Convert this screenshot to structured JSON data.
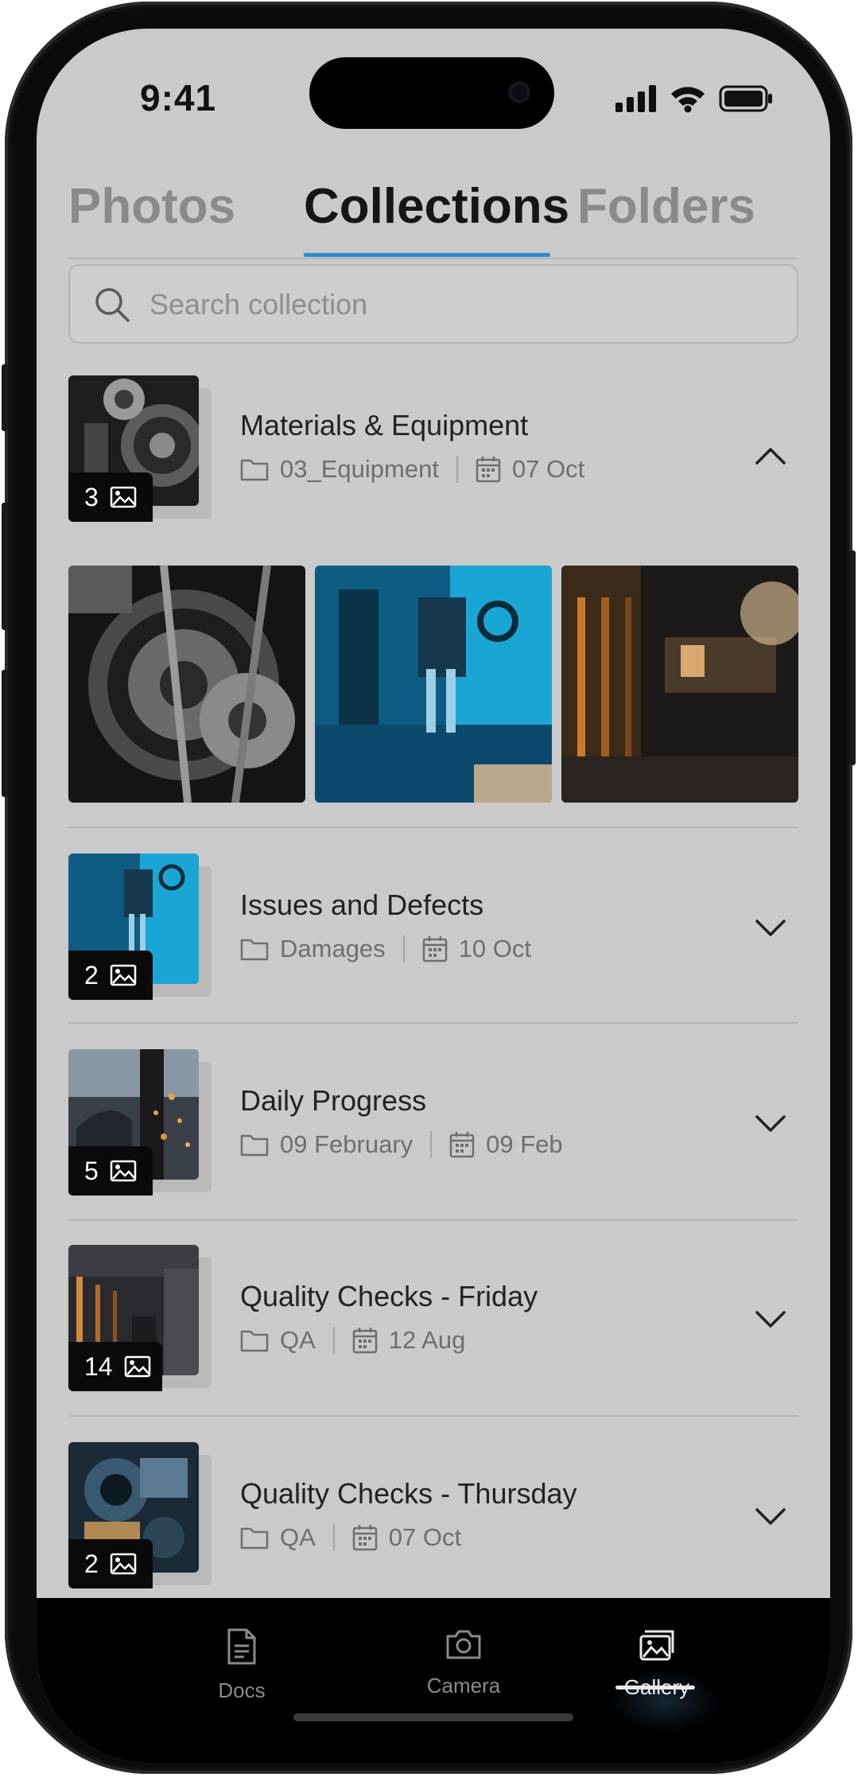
{
  "status_bar": {
    "time": "9:41"
  },
  "tabs": [
    {
      "label": "Photos",
      "active": false
    },
    {
      "label": "Collections",
      "active": true
    },
    {
      "label": "Folders",
      "active": false
    }
  ],
  "search": {
    "placeholder": "Search collection",
    "value": ""
  },
  "collections": [
    {
      "title": "Materials & Equipment",
      "count": "3",
      "folder": "03_Equipment",
      "date": "07 Oct",
      "expanded": true
    },
    {
      "title": "Issues and Defects",
      "count": "2",
      "folder": "Damages",
      "date": "10 Oct",
      "expanded": false
    },
    {
      "title": "Daily Progress",
      "count": "5",
      "folder": "09 February",
      "date": "09 Feb",
      "expanded": false
    },
    {
      "title": "Quality Checks - Friday",
      "count": "14",
      "folder": "QA",
      "date": "12 Aug",
      "expanded": false
    },
    {
      "title": "Quality Checks - Thursday",
      "count": "2",
      "folder": "QA",
      "date": "07 Oct",
      "expanded": false
    }
  ],
  "bottom_nav": [
    {
      "label": "Docs",
      "icon": "document-icon",
      "active": false
    },
    {
      "label": "Camera",
      "icon": "camera-icon",
      "active": false
    },
    {
      "label": "Gallery",
      "icon": "gallery-icon",
      "active": true
    }
  ],
  "colors": {
    "accent": "#2e8bd8",
    "screen_bg": "#cacaca",
    "nav_bg": "#000000"
  }
}
